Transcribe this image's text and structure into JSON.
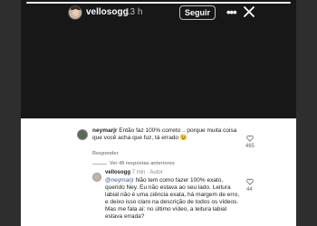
{
  "header": {
    "username": "vellosogg",
    "time": "13 h",
    "follow_label": "Seguir",
    "more_icon": "more-dots-icon",
    "close_icon": "close-icon"
  },
  "comment1": {
    "username": "neymarjr",
    "text": "Então faz 100% correto .. porque muita coisa que você acha que fuz, tá errado 😉",
    "reply_label": "Responder",
    "likes": "465"
  },
  "view_more": "Ver 49 respostas anteriores",
  "comment2": {
    "username": "vellosogg",
    "time": "7 min",
    "tag": "Autor",
    "mention": "@neymarjr",
    "text": " Não tem como fazer 100% exato, querido Ney. Eu não estava ao seu lado. Leitura labial não é uma ciência exata, há margem de erro, e deixo isso claro na descrição de todos os vídeos. Mas me fala aí: no último vídeo, a leitura labial estava errada?",
    "likes": "44"
  }
}
